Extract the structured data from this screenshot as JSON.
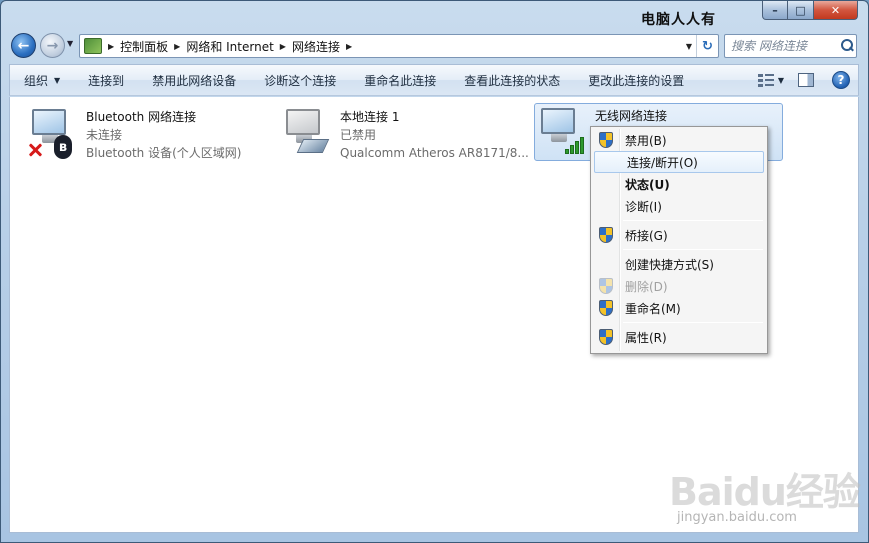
{
  "window": {
    "title": "电脑人人有"
  },
  "caption": {
    "min": "–",
    "max": "□",
    "close": "✕"
  },
  "nav": {
    "back": "←",
    "forward": "→",
    "breadcrumbs": [
      "控制面板",
      "网络和 Internet",
      "网络连接"
    ],
    "search_placeholder": "搜索 网络连接"
  },
  "toolbar": {
    "items": [
      "组织",
      "连接到",
      "禁用此网络设备",
      "诊断这个连接",
      "重命名此连接",
      "查看此连接的状态",
      "更改此连接的设置"
    ],
    "help": "?"
  },
  "connections": [
    {
      "name": "Bluetooth 网络连接",
      "status": "未连接",
      "device": "Bluetooth 设备(个人区域网)"
    },
    {
      "name": "本地连接 1",
      "status": "已禁用",
      "device": "Qualcomm Atheros AR8171/8..."
    },
    {
      "name": "无线网络连接",
      "status": "",
      "device": ""
    }
  ],
  "icons": {
    "bluetooth": "ʙ"
  },
  "context_menu": {
    "items": [
      "禁用(B)",
      "连接/断开(O)",
      "状态(U)",
      "诊断(I)",
      "桥接(G)",
      "创建快捷方式(S)",
      "删除(D)",
      "重命名(M)",
      "属性(R)"
    ]
  },
  "watermark": {
    "main": "Baidu经验",
    "sub": "jingyan.baidu.com"
  }
}
